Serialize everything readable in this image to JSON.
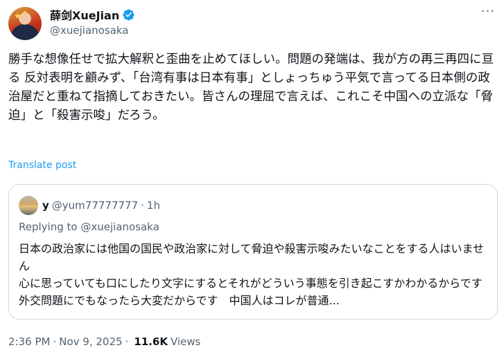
{
  "author": {
    "display_name": "薛剑XueJian",
    "handle": "@xuejianosaka"
  },
  "post": {
    "text": "勝手な想像任せで拡大解釈と歪曲を止めてほしい。問題の発端は、我が方の再三再四に亘る 反対表明を顧みず、「台湾有事は日本有事」としょっちゅう平気で言ってる日本側の政治屋だと重ねて指摘しておきたい。皆さんの理屈で言えば、これこそ中国への立派な「脅迫」と「殺害示唆」だろう。",
    "translate_label": "Translate post"
  },
  "quote": {
    "name": "y",
    "handle": "@yum77777777",
    "separator": "·",
    "time": "1h",
    "replying_to": "Replying to @xuejianosaka",
    "line1": "日本の政治家には他国の国民や政治家に対して脅迫や殺害示唆みたいなことをする人はいません",
    "line2": "心に思っていても口にしたり文字にするとそれがどういう事態を引き起こすかわかるからです　外交問題にでもなったら大変だからです　中国人はコレが普通..."
  },
  "footer": {
    "time": "2:36 PM",
    "sep1": "·",
    "date": "Nov 9, 2025",
    "sep2": "·",
    "views_count": "11.6K",
    "views_label": "Views"
  },
  "icons": {
    "verified": "verified-badge-icon",
    "more": "more-options-icon"
  },
  "colors": {
    "accent": "#1d9bf0",
    "secondary_text": "#536471",
    "border": "#cfd9de"
  }
}
